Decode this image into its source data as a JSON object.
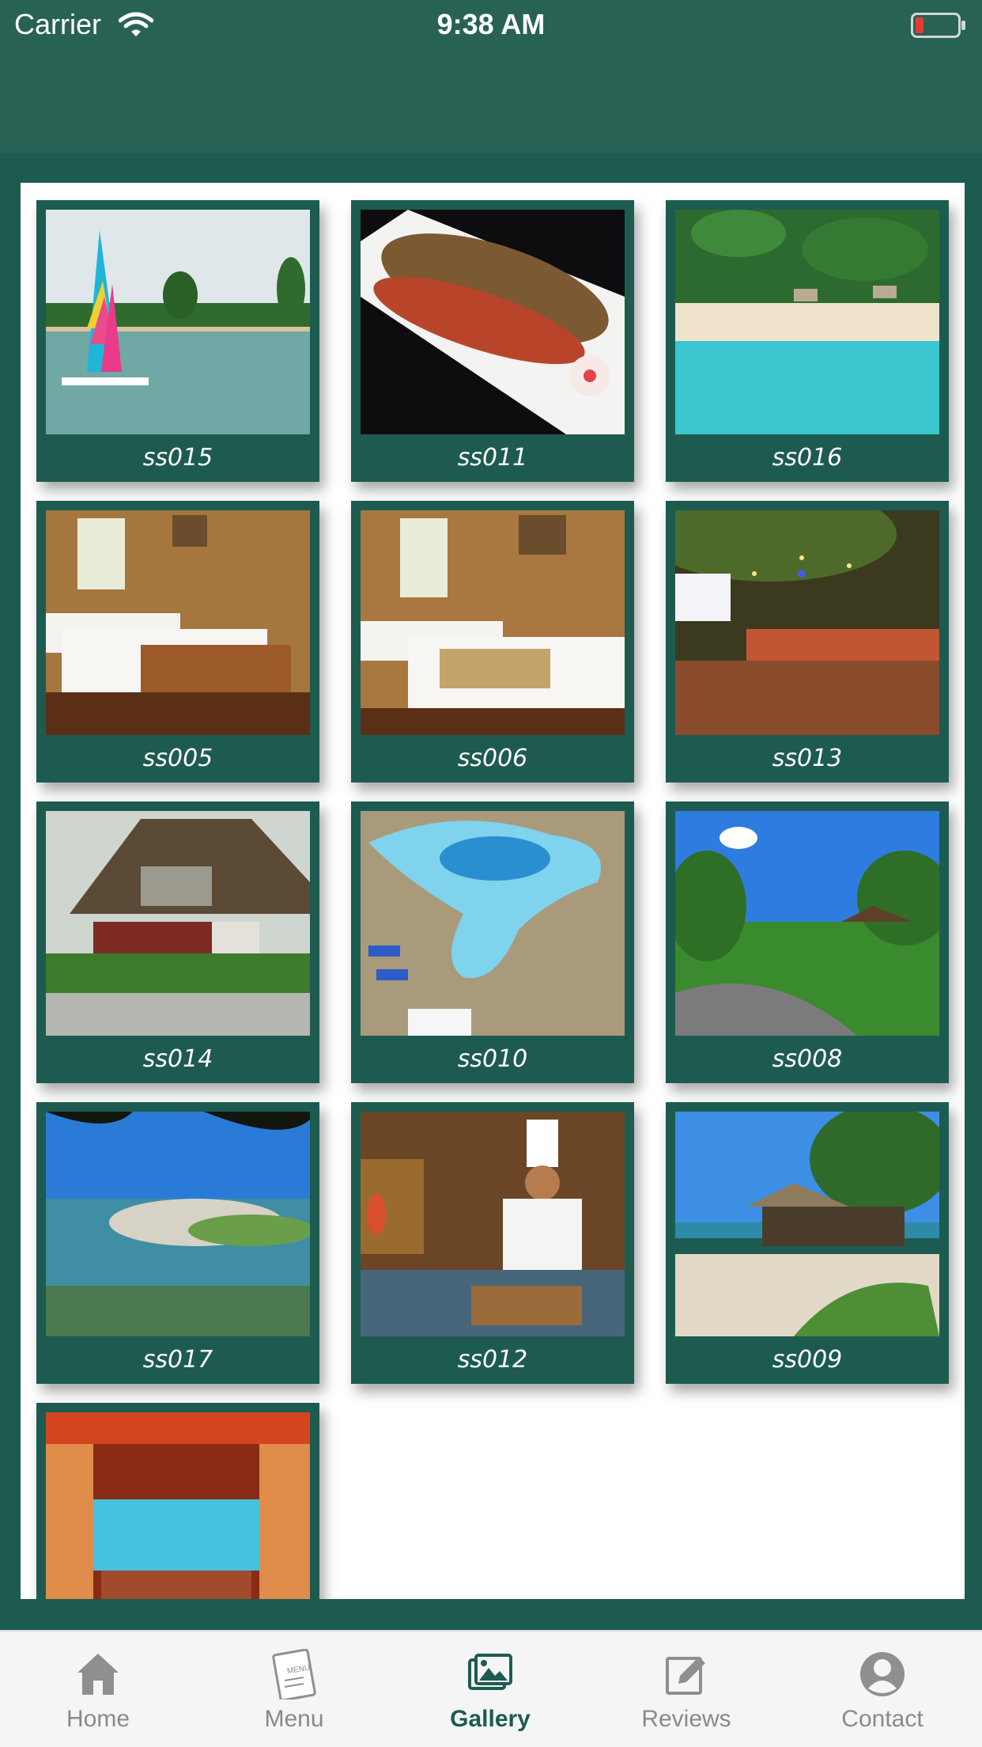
{
  "status_bar": {
    "carrier": "Carrier",
    "time": "9:38 AM"
  },
  "gallery": {
    "items": [
      {
        "caption": "ss015"
      },
      {
        "caption": "ss011"
      },
      {
        "caption": "ss016"
      },
      {
        "caption": "ss005"
      },
      {
        "caption": "ss006"
      },
      {
        "caption": "ss013"
      },
      {
        "caption": "ss014"
      },
      {
        "caption": "ss010"
      },
      {
        "caption": "ss008"
      },
      {
        "caption": "ss017"
      },
      {
        "caption": "ss012"
      },
      {
        "caption": "ss009"
      },
      {
        "caption": ""
      }
    ]
  },
  "tabbar": {
    "tabs": [
      {
        "label": "Home",
        "icon": "home-icon"
      },
      {
        "label": "Menu",
        "icon": "menu-card-icon"
      },
      {
        "label": "Gallery",
        "icon": "gallery-icon",
        "active": true
      },
      {
        "label": "Reviews",
        "icon": "edit-icon"
      },
      {
        "label": "Contact",
        "icon": "person-icon"
      }
    ]
  },
  "colors": {
    "brand": "#1d5b50",
    "header": "#286254",
    "inactive": "#8a8a8a"
  }
}
